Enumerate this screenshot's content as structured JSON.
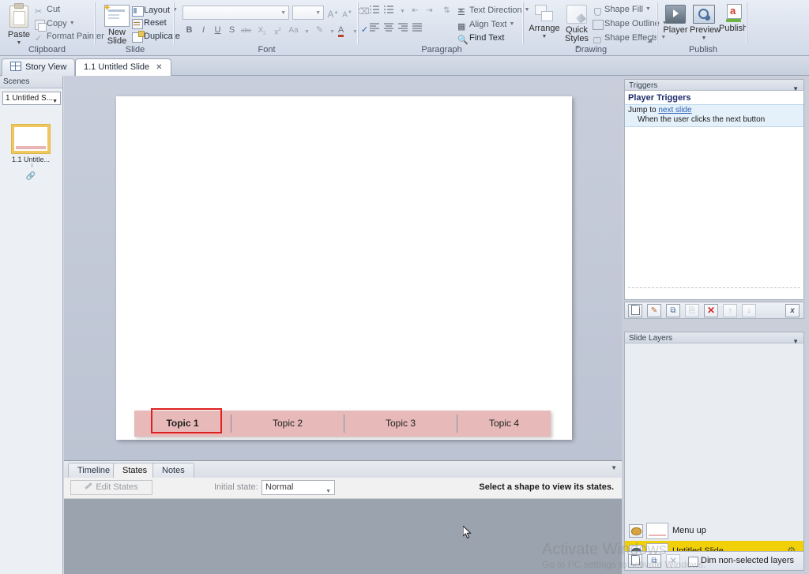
{
  "ribbon": {
    "groups": [
      {
        "name": "Clipboard",
        "label": "Clipboard"
      },
      {
        "name": "Slide",
        "label": "Slide"
      },
      {
        "name": "Font",
        "label": "Font"
      },
      {
        "name": "Paragraph",
        "label": "Paragraph"
      },
      {
        "name": "Drawing",
        "label": "Drawing"
      },
      {
        "name": "Publish",
        "label": "Publish"
      }
    ],
    "clipboard": {
      "paste": "Paste",
      "cut": "Cut",
      "copy": "Copy",
      "format_painter": "Format Painter"
    },
    "slide": {
      "new_slide_line1": "New",
      "new_slide_line2": "Slide",
      "layout": "Layout",
      "reset": "Reset",
      "duplicate": "Duplicate"
    },
    "font": {
      "font_name": "",
      "font_size": "",
      "grow": "A",
      "shrink": "A",
      "clear_format": "",
      "bold": "B",
      "italic": "I",
      "underline": "U",
      "shadow": "S",
      "strikethrough": "abc",
      "subscript": "X",
      "superscript": "x",
      "change_case": "Aa",
      "highlight": "",
      "font_color": "A",
      "spellcheck": ""
    },
    "paragraph": {
      "text_direction": "Text Direction",
      "align_text": "Align Text",
      "find_text": "Find Text"
    },
    "drawing": {
      "arrange": "Arrange",
      "quick_styles_l1": "Quick",
      "quick_styles_l2": "Styles",
      "shape_fill": "Shape Fill",
      "shape_outline": "Shape Outline",
      "shape_effects": "Shape Effects"
    },
    "publish": {
      "player": "Player",
      "preview": "Preview",
      "publish": "Publish"
    }
  },
  "tabs": [
    {
      "label": "Story View",
      "active": false,
      "closable": false
    },
    {
      "label": "1.1 Untitled Slide",
      "active": true,
      "closable": true,
      "close": "✕"
    }
  ],
  "scenes": {
    "header": "Scenes",
    "selected_scene": "1 Untitled S...",
    "thumbnail_label": "1.1 Untitle..."
  },
  "slide": {
    "menu_bar": {
      "topics": [
        "Topic 1",
        "Topic 2",
        "Topic 3",
        "Topic 4"
      ],
      "selected_index": 0,
      "fill_color": "#e7b9b9",
      "selection_color": "#e02020"
    }
  },
  "bottom_panel": {
    "tabs": [
      {
        "label": "Timeline",
        "active": false
      },
      {
        "label": "States",
        "active": true
      },
      {
        "label": "Notes",
        "active": false
      }
    ],
    "edit_states": "Edit States",
    "initial_state_label": "Initial state:",
    "initial_state_value": "Normal",
    "hint": "Select a shape to view its states."
  },
  "triggers": {
    "header": "Triggers",
    "section_title": "Player Triggers",
    "item": {
      "action_prefix": "Jump to",
      "action_target": "next slide",
      "condition": "When the user clicks the next button"
    },
    "toolbar": [
      {
        "name": "new-trigger",
        "glyph": "□"
      },
      {
        "name": "edit-trigger",
        "glyph": "✎"
      },
      {
        "name": "copy-trigger",
        "glyph": "⧉"
      },
      {
        "name": "paste-trigger",
        "glyph": "⎘"
      },
      {
        "name": "delete-trigger",
        "glyph": "✕"
      },
      {
        "name": "move-up",
        "glyph": "↑"
      },
      {
        "name": "move-down",
        "glyph": "↓"
      },
      {
        "name": "variables",
        "glyph": "x"
      }
    ]
  },
  "slide_layers": {
    "header": "Slide Layers",
    "rows": [
      {
        "name": "Menu up",
        "selected": false
      },
      {
        "name": "Untitled Slide",
        "selected": true
      }
    ],
    "toolbar": [
      {
        "name": "new-layer",
        "glyph": "□"
      },
      {
        "name": "duplicate-layer",
        "glyph": "⧉"
      },
      {
        "name": "delete-layer",
        "glyph": "✕"
      }
    ],
    "dim_checkbox_label": "Dim non-selected layers",
    "dim_checked": false,
    "selected_color": "#f2d007"
  },
  "watermark": {
    "line1": "Activate Windows",
    "line2": "Go to PC settings to activate Windows."
  }
}
